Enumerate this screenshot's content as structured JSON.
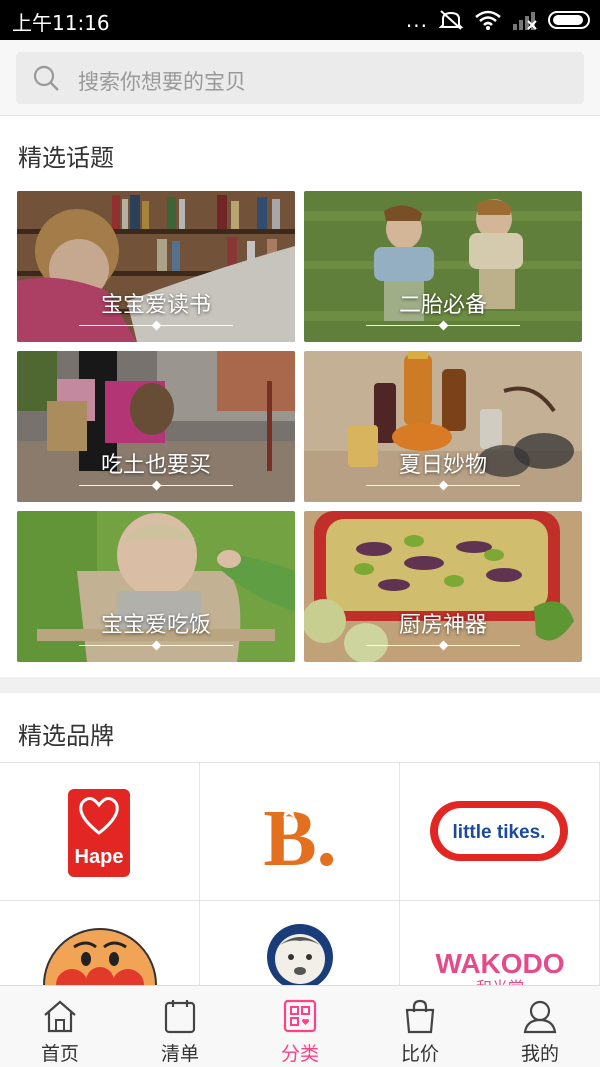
{
  "status_bar": {
    "time": "上午11:16",
    "dots": "..."
  },
  "search": {
    "placeholder": "搜索你想要的宝贝"
  },
  "topics_section": {
    "title": "精选话题",
    "tiles": [
      {
        "label": "宝宝爱读书"
      },
      {
        "label": "二胎必备"
      },
      {
        "label": "吃土也要买"
      },
      {
        "label": "夏日妙物"
      },
      {
        "label": "宝宝爱吃饭"
      },
      {
        "label": "厨房神器"
      }
    ]
  },
  "brands_section": {
    "title": "精选品牌",
    "brands": [
      {
        "name": "Hape"
      },
      {
        "name": "B."
      },
      {
        "name": "little tikes."
      },
      {
        "name": "anpanman"
      },
      {
        "name": "gerber"
      },
      {
        "name": "WAKODO",
        "sub": "和光堂"
      }
    ]
  },
  "bottom_nav": {
    "items": [
      {
        "label": "首页",
        "icon": "home-icon"
      },
      {
        "label": "清单",
        "icon": "list-icon"
      },
      {
        "label": "分类",
        "icon": "category-icon"
      },
      {
        "label": "比价",
        "icon": "bag-icon"
      },
      {
        "label": "我的",
        "icon": "user-icon"
      }
    ],
    "active_index": 2
  },
  "colors": {
    "accent": "#ff3f87",
    "status_bar": "#000000"
  }
}
